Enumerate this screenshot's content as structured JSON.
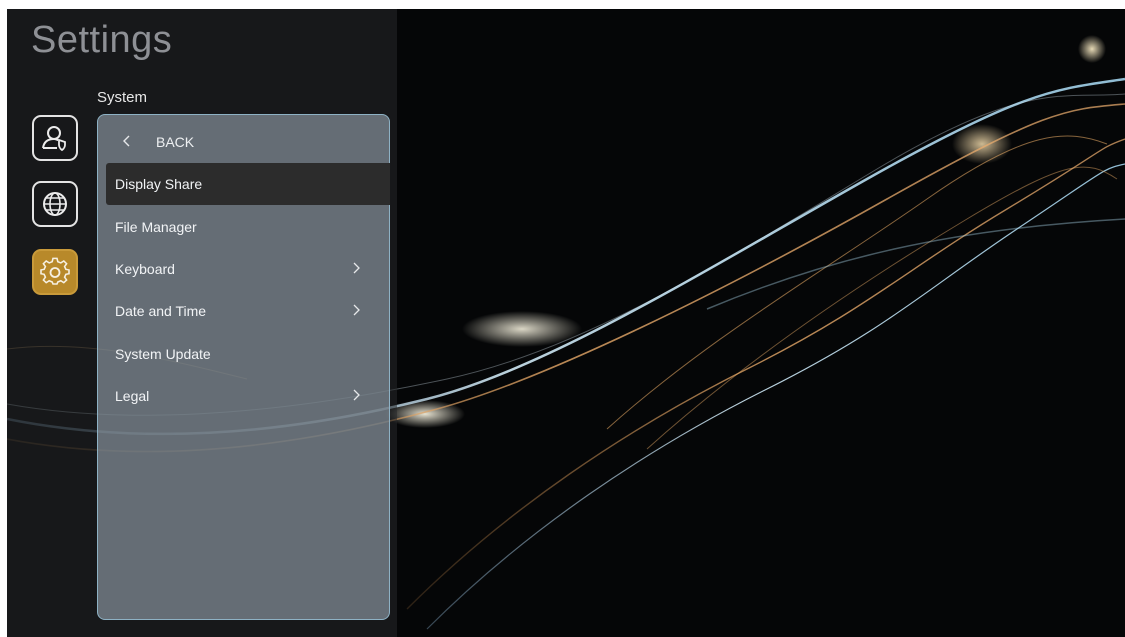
{
  "header": {
    "title": "Settings",
    "subtitle": "System"
  },
  "categories": [
    {
      "icon": "user-privacy-icon",
      "active": false
    },
    {
      "icon": "globe-network-icon",
      "active": false
    },
    {
      "icon": "gear-icon",
      "active": true
    }
  ],
  "panel": {
    "back_label": "BACK",
    "items": [
      {
        "label": "Display Share",
        "has_submenu": false,
        "selected": true
      },
      {
        "label": "File Manager",
        "has_submenu": false,
        "selected": false
      },
      {
        "label": "Keyboard",
        "has_submenu": true,
        "selected": false
      },
      {
        "label": "Date and Time",
        "has_submenu": true,
        "selected": false
      },
      {
        "label": "System Update",
        "has_submenu": false,
        "selected": false
      },
      {
        "label": "Legal",
        "has_submenu": true,
        "selected": false
      }
    ]
  },
  "colors": {
    "accent": "#b8892a",
    "panel_border": "#8eb2c5",
    "selected_row": "#2c2c2c"
  }
}
